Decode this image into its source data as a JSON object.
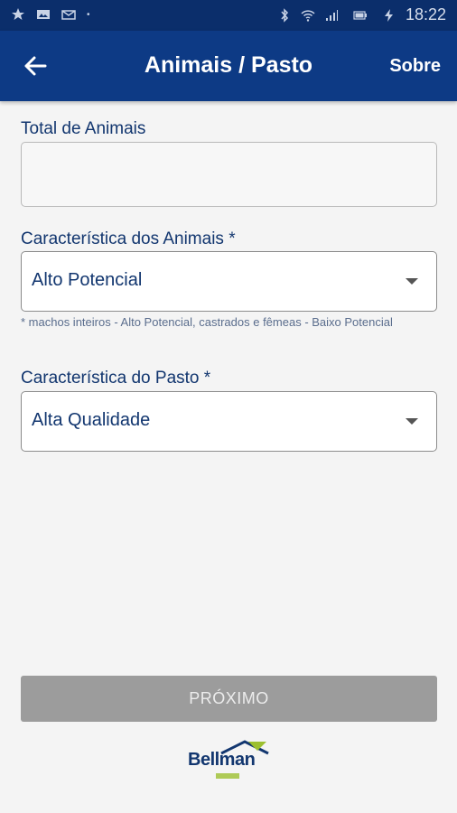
{
  "status_bar": {
    "time": "18:22"
  },
  "app_bar": {
    "title": "Animais / Pasto",
    "about_label": "Sobre"
  },
  "form": {
    "total_animais": {
      "label": "Total de Animais",
      "value": ""
    },
    "caracteristica_animais": {
      "label": "Característica dos Animais *",
      "selected": "Alto Potencial",
      "hint": "* machos inteiros - Alto Potencial, castrados e fêmeas - Baixo Potencial"
    },
    "caracteristica_pasto": {
      "label": "Característica do Pasto *",
      "selected": "Alta Qualidade"
    }
  },
  "next_button": {
    "label": "PRÓXIMO"
  },
  "logo": {
    "brand": "Bellman"
  },
  "colors": {
    "app_bar": "#0d3a85",
    "status_bar": "#0b2e6b",
    "text_primary": "#12366f",
    "button_disabled": "#9c9c9c",
    "logo_accent": "#8fae2e"
  }
}
